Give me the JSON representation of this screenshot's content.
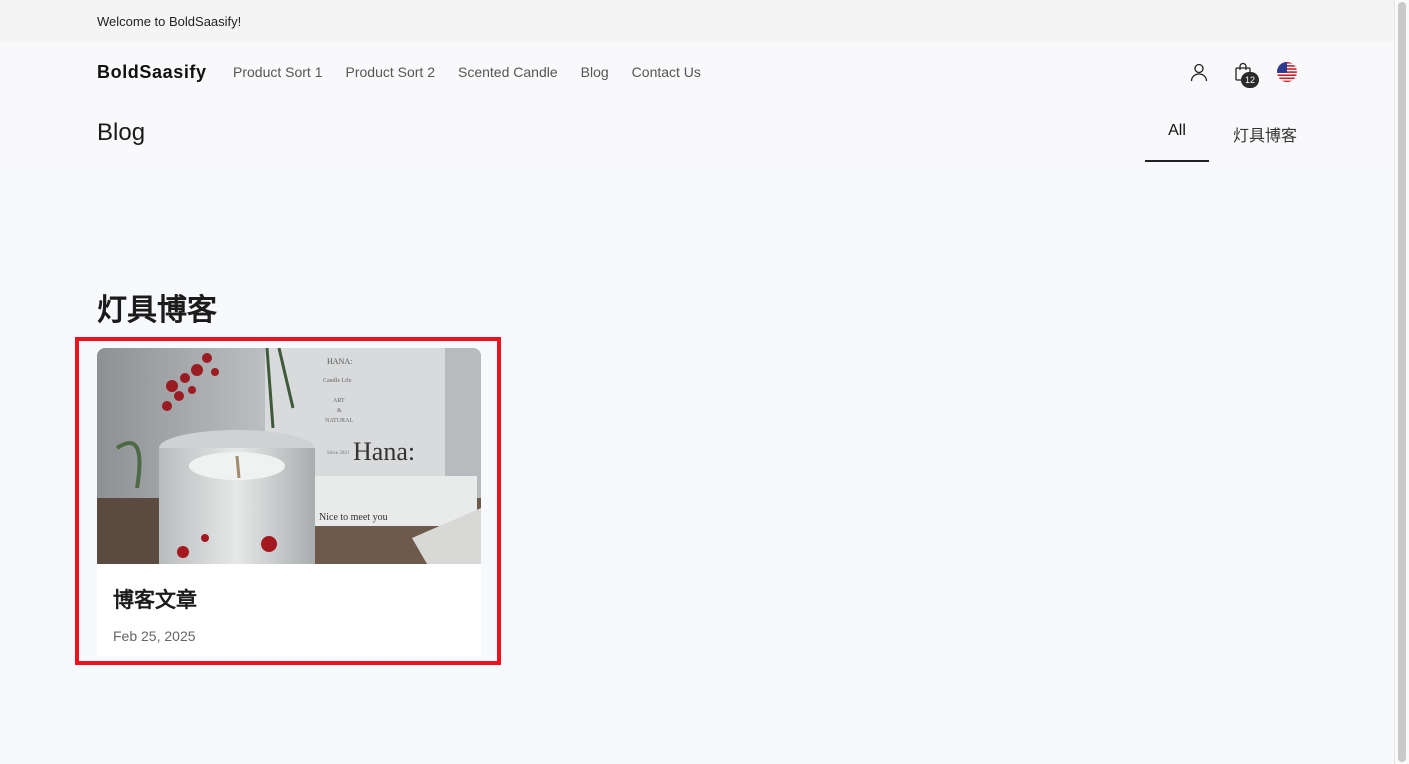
{
  "announcement": "Welcome to BoldSaasify!",
  "header": {
    "logo": "BoldSaasify",
    "nav": [
      "Product Sort 1",
      "Product Sort 2",
      "Scented Candle",
      "Blog",
      "Contact Us"
    ],
    "cart_count": "12",
    "icons": [
      "user-icon",
      "shopping-bag-icon",
      "us-flag-icon"
    ]
  },
  "blog": {
    "title": "Blog",
    "tabs": [
      "All",
      "灯具博客"
    ],
    "active_tab": "All"
  },
  "section": {
    "title": "灯具博客"
  },
  "card": {
    "title": "博客文章",
    "date": "Feb 25, 2025",
    "image_texts": {
      "box_brand": "HANA:",
      "box_line": "Candle Life",
      "box_art1": "ART",
      "box_art2": "&",
      "box_art3": "NATURAL",
      "box_since": "Since 2021",
      "box_big": "Hana:",
      "card_text": "Nice to meet you"
    }
  },
  "colors": {
    "highlight": "#f0101e",
    "background": "#f8f9fc",
    "announcement_bg": "#f4f4f4"
  }
}
